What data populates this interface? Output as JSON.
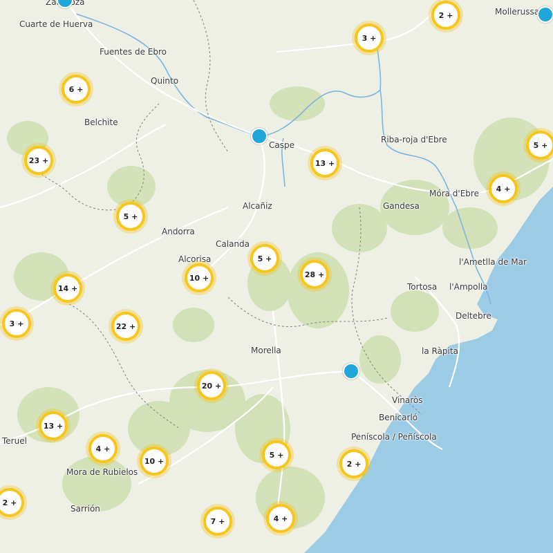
{
  "map": {
    "colors": {
      "land": "#eef0e6",
      "vegetation": "#cfe0b3",
      "sea": "#9ccbe6",
      "river": "#7ab6e0",
      "road": "#ffffff",
      "border": "#8a8a8a",
      "cluster_ring": "#f7c61d",
      "marker": "#1ea7d8"
    },
    "places": [
      {
        "id": "zaragoza",
        "name": "Zaragoza"
      },
      {
        "id": "cuarte",
        "name": "Cuarte de Huerva"
      },
      {
        "id": "fuentes",
        "name": "Fuentes de Ebro"
      },
      {
        "id": "quinto",
        "name": "Quinto"
      },
      {
        "id": "belchite",
        "name": "Belchite"
      },
      {
        "id": "caspe",
        "name": "Caspe"
      },
      {
        "id": "mollerussa",
        "name": "Mollerussa"
      },
      {
        "id": "ribaroja",
        "name": "Riba-roja d'Ebre"
      },
      {
        "id": "mora",
        "name": "Móra d'Ebre"
      },
      {
        "id": "gandesa",
        "name": "Gandesa"
      },
      {
        "id": "alcaniz",
        "name": "Alcañiz"
      },
      {
        "id": "andorra",
        "name": "Andorra"
      },
      {
        "id": "calanda",
        "name": "Calanda"
      },
      {
        "id": "alcorisa",
        "name": "Alcorisa"
      },
      {
        "id": "ametlla",
        "name": "l'Ametlla de Mar"
      },
      {
        "id": "tortosa",
        "name": "Tortosa"
      },
      {
        "id": "ampolla",
        "name": "l'Ampolla"
      },
      {
        "id": "deltebre",
        "name": "Deltebre"
      },
      {
        "id": "rapita",
        "name": "la Ràpita"
      },
      {
        "id": "morella",
        "name": "Morella"
      },
      {
        "id": "vinaros",
        "name": "Vinaròs"
      },
      {
        "id": "benicarlo",
        "name": "Benicarló"
      },
      {
        "id": "peniscola",
        "name": "Peníscola / Peñíscola"
      },
      {
        "id": "teruel",
        "name": "Teruel"
      },
      {
        "id": "mora_rubielos",
        "name": "Mora de Rubielos"
      },
      {
        "id": "sarrion",
        "name": "Sarrión"
      }
    ],
    "clusters": [
      {
        "id": "c1",
        "label": "2 +"
      },
      {
        "id": "c2",
        "label": "3 +"
      },
      {
        "id": "c3",
        "label": "6 +"
      },
      {
        "id": "c4",
        "label": "23 +"
      },
      {
        "id": "c5",
        "label": "13 +"
      },
      {
        "id": "c6",
        "label": "5 +"
      },
      {
        "id": "c7",
        "label": "4 +"
      },
      {
        "id": "c8",
        "label": "5 +"
      },
      {
        "id": "c9",
        "label": "5 +"
      },
      {
        "id": "c10",
        "label": "10 +"
      },
      {
        "id": "c11",
        "label": "28 +"
      },
      {
        "id": "c12",
        "label": "14 +"
      },
      {
        "id": "c13",
        "label": "3 +"
      },
      {
        "id": "c14",
        "label": "22 +"
      },
      {
        "id": "c15",
        "label": "20 +"
      },
      {
        "id": "c16",
        "label": "13 +"
      },
      {
        "id": "c17",
        "label": "4 +"
      },
      {
        "id": "c18",
        "label": "10 +"
      },
      {
        "id": "c19",
        "label": "5 +"
      },
      {
        "id": "c20",
        "label": "2 +"
      },
      {
        "id": "c21",
        "label": "2 +"
      },
      {
        "id": "c22",
        "label": "7 +"
      },
      {
        "id": "c23",
        "label": "4 +"
      }
    ],
    "markers": [
      {
        "id": "m1"
      },
      {
        "id": "m2"
      },
      {
        "id": "m3"
      },
      {
        "id": "m4"
      }
    ]
  }
}
